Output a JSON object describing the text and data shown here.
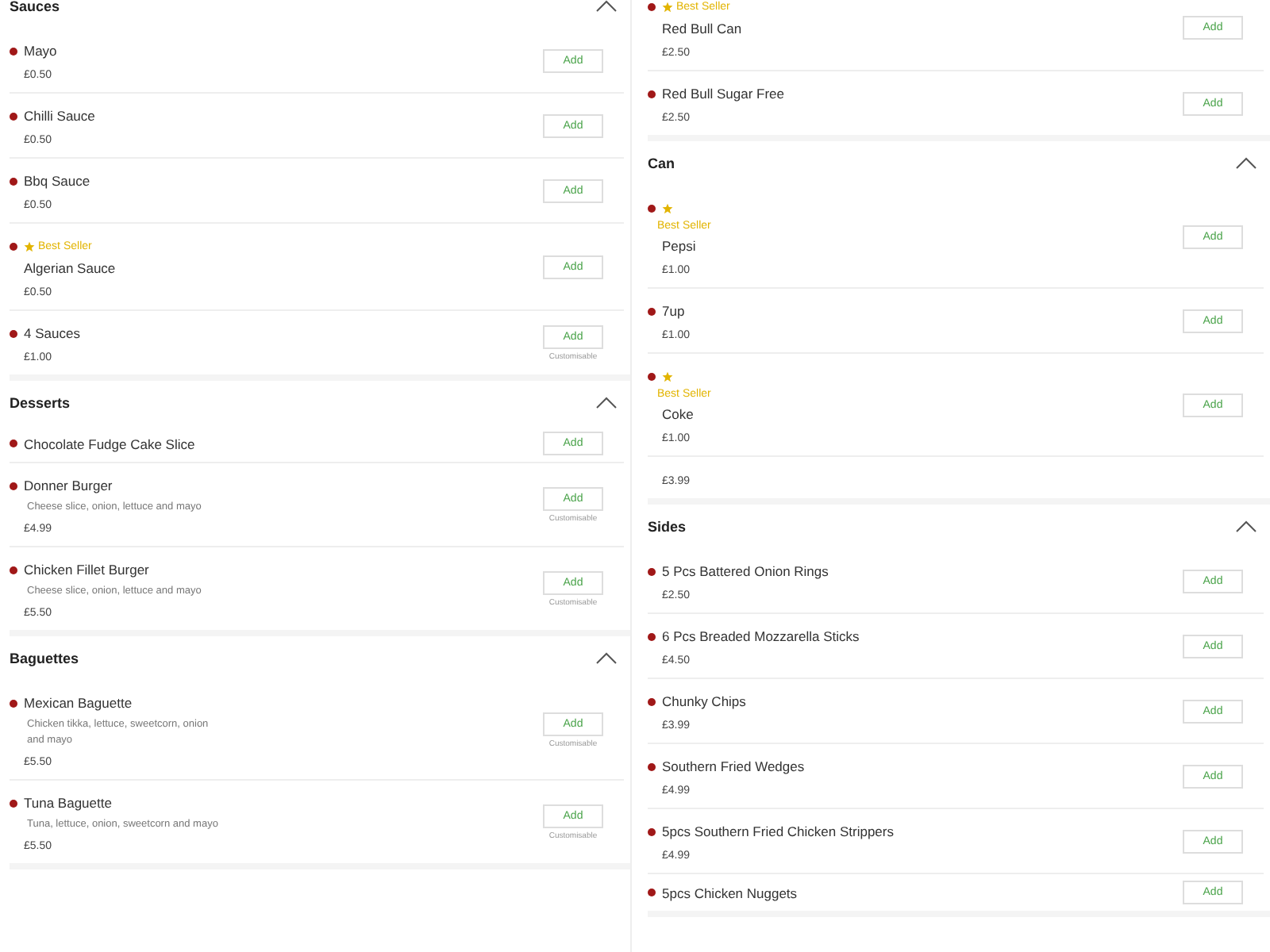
{
  "columns": [
    {
      "sections": [
        {
          "title": "Sauces",
          "expanded": true,
          "items": [
            {
              "name": "Mayo",
              "price": "£0.50",
              "button": "Add"
            },
            {
              "name": "Chilli Sauce",
              "price": "£0.50",
              "button": "Add"
            },
            {
              "name": "Bbq Sauce",
              "price": "£0.50",
              "button": "Add"
            },
            {
              "badge": {
                "kind": "inline",
                "label": "Best Seller"
              },
              "name": "Algerian Sauce",
              "price": "£0.50",
              "button": "Add"
            },
            {
              "name": "4 Sauces",
              "price": "£1.00",
              "button": "Add",
              "note": "Customisable"
            }
          ]
        },
        {
          "title": "Desserts",
          "expanded": true,
          "items": [
            {
              "name": "Chocolate Fudge Cake Slice",
              "button": "Add"
            },
            {
              "name": "Donner Burger",
              "description": "Cheese slice, onion, lettuce and mayo",
              "price": "£4.99",
              "button": "Add",
              "note": "Customisable"
            },
            {
              "name": "Chicken Fillet Burger",
              "description": "Cheese slice, onion, lettuce and mayo",
              "price": "£5.50",
              "button": "Add",
              "note": "Customisable"
            }
          ]
        },
        {
          "title": "Baguettes",
          "expanded": true,
          "items": [
            {
              "name": "Mexican Baguette",
              "description": "Chicken tikka, lettuce, sweetcorn, onion and mayo",
              "price": "£5.50",
              "button": "Add",
              "note": "Customisable"
            },
            {
              "name": "Tuna Baguette",
              "description": "Tuna, lettuce, onion, sweetcorn and mayo",
              "price": "£5.50",
              "button": "Add",
              "note": "Customisable"
            }
          ]
        }
      ]
    },
    {
      "sections": [
        {
          "items": [
            {
              "badge": {
                "kind": "inline",
                "label": "Best Seller"
              },
              "name": "Red Bull Can",
              "price": "£2.50",
              "button": "Add"
            },
            {
              "name": "Red Bull Sugar Free",
              "price": "£2.50",
              "button": "Add"
            }
          ]
        },
        {
          "title": "Can",
          "expanded": true,
          "items": [
            {
              "badge": {
                "kind": "stacked",
                "label": "Best Seller"
              },
              "name": "Pepsi",
              "price": "£1.00",
              "button": "Add"
            },
            {
              "name": "7up",
              "price": "£1.00",
              "button": "Add"
            },
            {
              "badge": {
                "kind": "stacked",
                "label": "Best Seller"
              },
              "name": "Coke",
              "price": "£1.00",
              "button": "Add"
            },
            {
              "price": "£3.99"
            }
          ]
        },
        {
          "title": "Sides",
          "expanded": true,
          "items": [
            {
              "name": "5 Pcs Battered Onion Rings",
              "price": "£2.50",
              "button": "Add"
            },
            {
              "name": "6 Pcs Breaded Mozzarella Sticks",
              "price": "£4.50",
              "button": "Add"
            },
            {
              "name": "Chunky Chips",
              "price": "£3.99",
              "button": "Add"
            },
            {
              "name": "Southern Fried Wedges",
              "price": "£4.99",
              "button": "Add"
            },
            {
              "name": "5pcs Southern Fried Chicken Strippers",
              "price": "£4.99",
              "button": "Add"
            },
            {
              "name": "5pcs Chicken Nuggets",
              "button": "Add"
            }
          ]
        }
      ]
    }
  ]
}
